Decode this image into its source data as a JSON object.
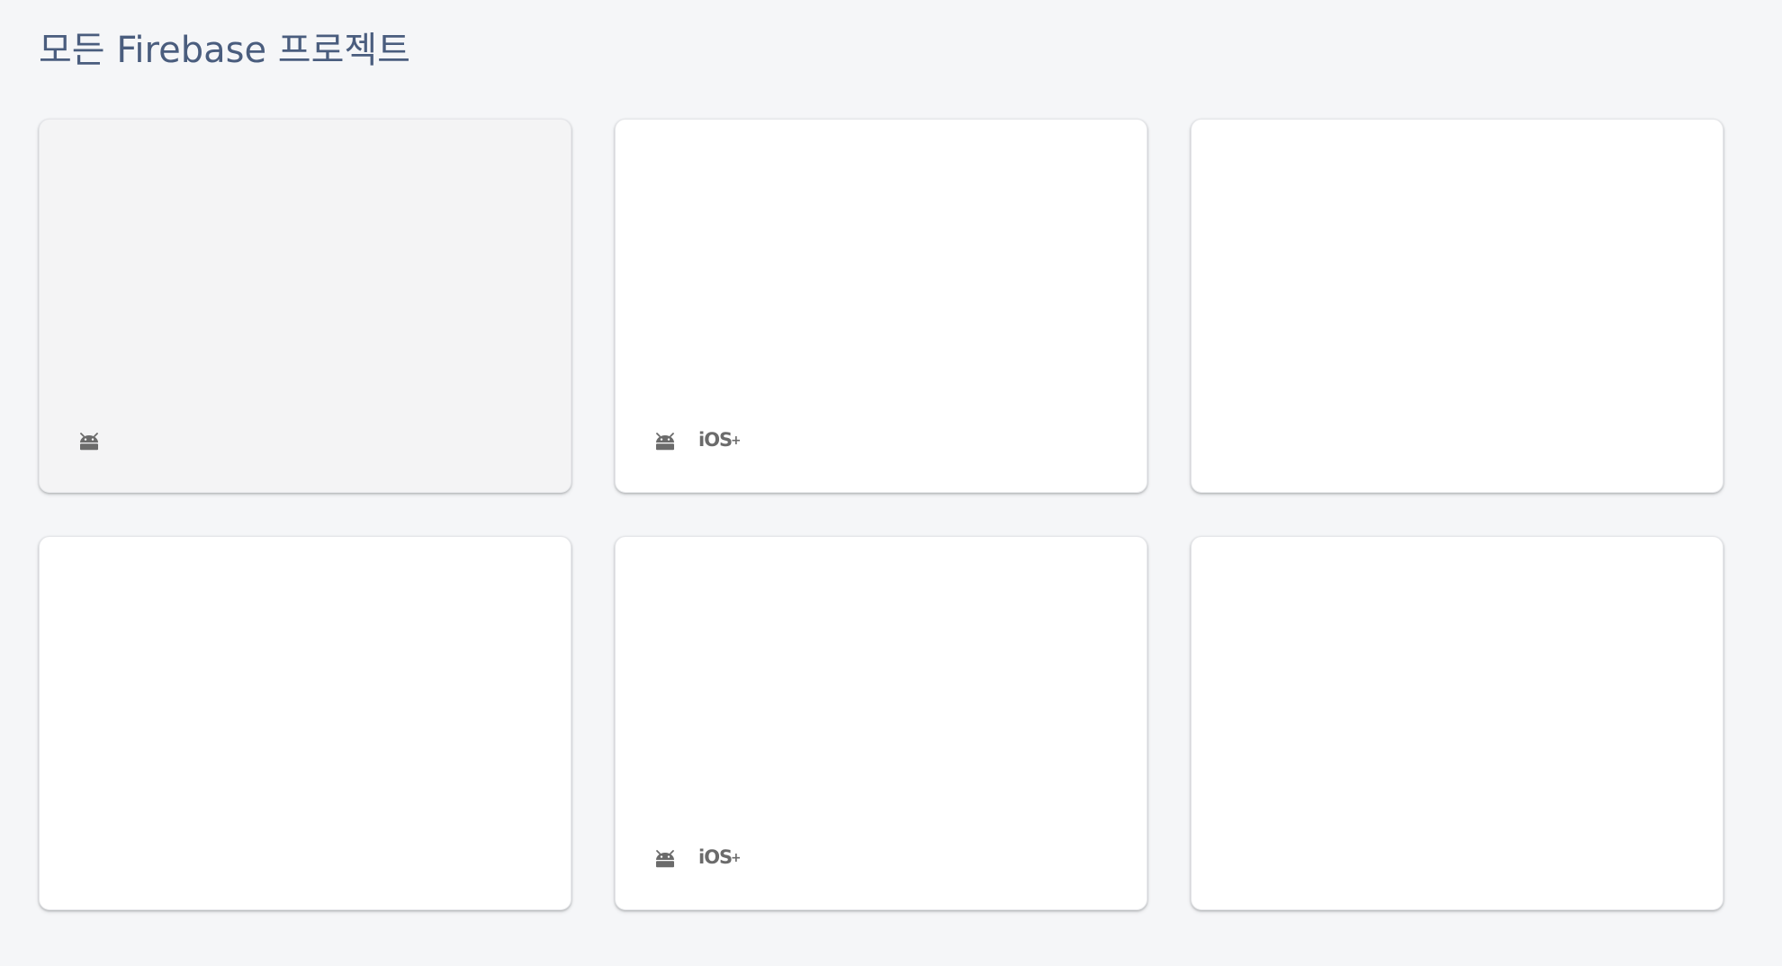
{
  "page": {
    "title": "모든 Firebase 프로젝트"
  },
  "colors": {
    "background": "#f5f6f8",
    "title": "#4a5d7e",
    "card": "#ffffff",
    "card_hover": "#f4f4f5",
    "icon": "#6b6b6b"
  },
  "projects": [
    {
      "platforms": [
        "android-icon"
      ],
      "state": "hovered"
    },
    {
      "platforms": [
        "android-icon",
        "ios-plus-icon"
      ],
      "state": "normal"
    },
    {
      "platforms": [],
      "state": "normal"
    },
    {
      "platforms": [],
      "state": "normal"
    },
    {
      "platforms": [
        "android-icon",
        "ios-plus-icon"
      ],
      "state": "normal"
    },
    {
      "platforms": [],
      "state": "normal"
    }
  ],
  "icons": {
    "ios_label": "iOS+"
  }
}
